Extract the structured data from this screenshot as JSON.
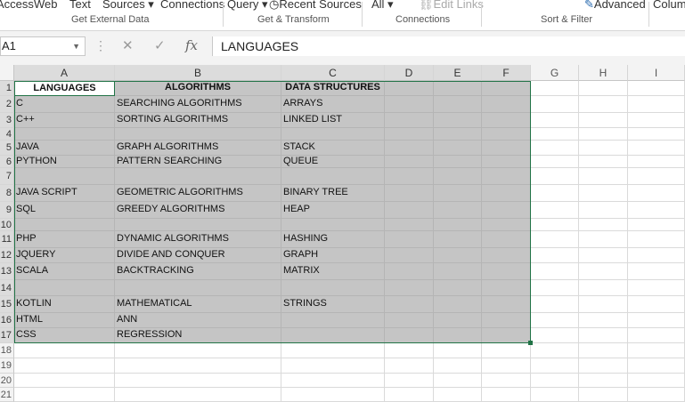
{
  "ribbon": {
    "items": [
      {
        "key": "access",
        "label": "Access"
      },
      {
        "key": "web",
        "label": "Web"
      },
      {
        "key": "text",
        "label": "Text"
      },
      {
        "key": "sources",
        "label": "Sources ▾"
      },
      {
        "key": "connections",
        "label": "Connections"
      },
      {
        "key": "query",
        "label": "Query ▾"
      },
      {
        "key": "recent",
        "label": "Recent Sources"
      },
      {
        "key": "all",
        "label": "All ▾"
      },
      {
        "key": "editlinks",
        "label": "Edit Links"
      },
      {
        "key": "advanced",
        "label": "Advanced"
      },
      {
        "key": "column",
        "label": "Colum"
      }
    ],
    "groups": [
      "Get External Data",
      "Get & Transform",
      "Connections",
      "Sort & Filter"
    ]
  },
  "formula_bar": {
    "name_box": "A1",
    "cancel_icon": "✕",
    "enter_icon": "✓",
    "fx_label": "fx",
    "content": "LANGUAGES"
  },
  "columns": [
    "A",
    "B",
    "C",
    "D",
    "E",
    "F",
    "G",
    "H",
    "I"
  ],
  "rows": [
    "1",
    "2",
    "3",
    "4",
    "5",
    "6",
    "7",
    "8",
    "9",
    "10",
    "11",
    "12",
    "13",
    "14",
    "15",
    "16",
    "17",
    "18",
    "19",
    "20",
    "21"
  ],
  "cells": {
    "header": [
      "LANGUAGES",
      "ALGORITHMS",
      "DATA STRUCTURES"
    ],
    "data": [
      [
        "C",
        "SEARCHING ALGORITHMS",
        "ARRAYS"
      ],
      [
        "C++",
        "SORTING ALGORITHMS",
        "LINKED LIST"
      ],
      [
        "",
        "",
        ""
      ],
      [
        "JAVA",
        "GRAPH ALGORITHMS",
        "STACK"
      ],
      [
        "PYTHON",
        "PATTERN SEARCHING",
        "QUEUE"
      ],
      [
        "",
        "",
        ""
      ],
      [
        "JAVA SCRIPT",
        "GEOMETRIC ALGORITHMS",
        "BINARY TREE"
      ],
      [
        "SQL",
        "GREEDY ALGORITHMS",
        "HEAP"
      ],
      [
        "",
        "",
        ""
      ],
      [
        "PHP",
        "DYNAMIC ALGORITHMS",
        "HASHING"
      ],
      [
        "JQUERY",
        "DIVIDE AND CONQUER",
        "GRAPH"
      ],
      [
        "SCALA",
        "BACKTRACKING",
        "MATRIX"
      ],
      [
        "",
        "",
        ""
      ],
      [
        "KOTLIN",
        "MATHEMATICAL",
        "STRINGS"
      ],
      [
        "HTML",
        "ANN",
        ""
      ],
      [
        "CSS",
        "REGRESSION",
        ""
      ]
    ]
  },
  "colors": {
    "selection_border": "#217346",
    "selection_fill": "#c5c5c5"
  }
}
